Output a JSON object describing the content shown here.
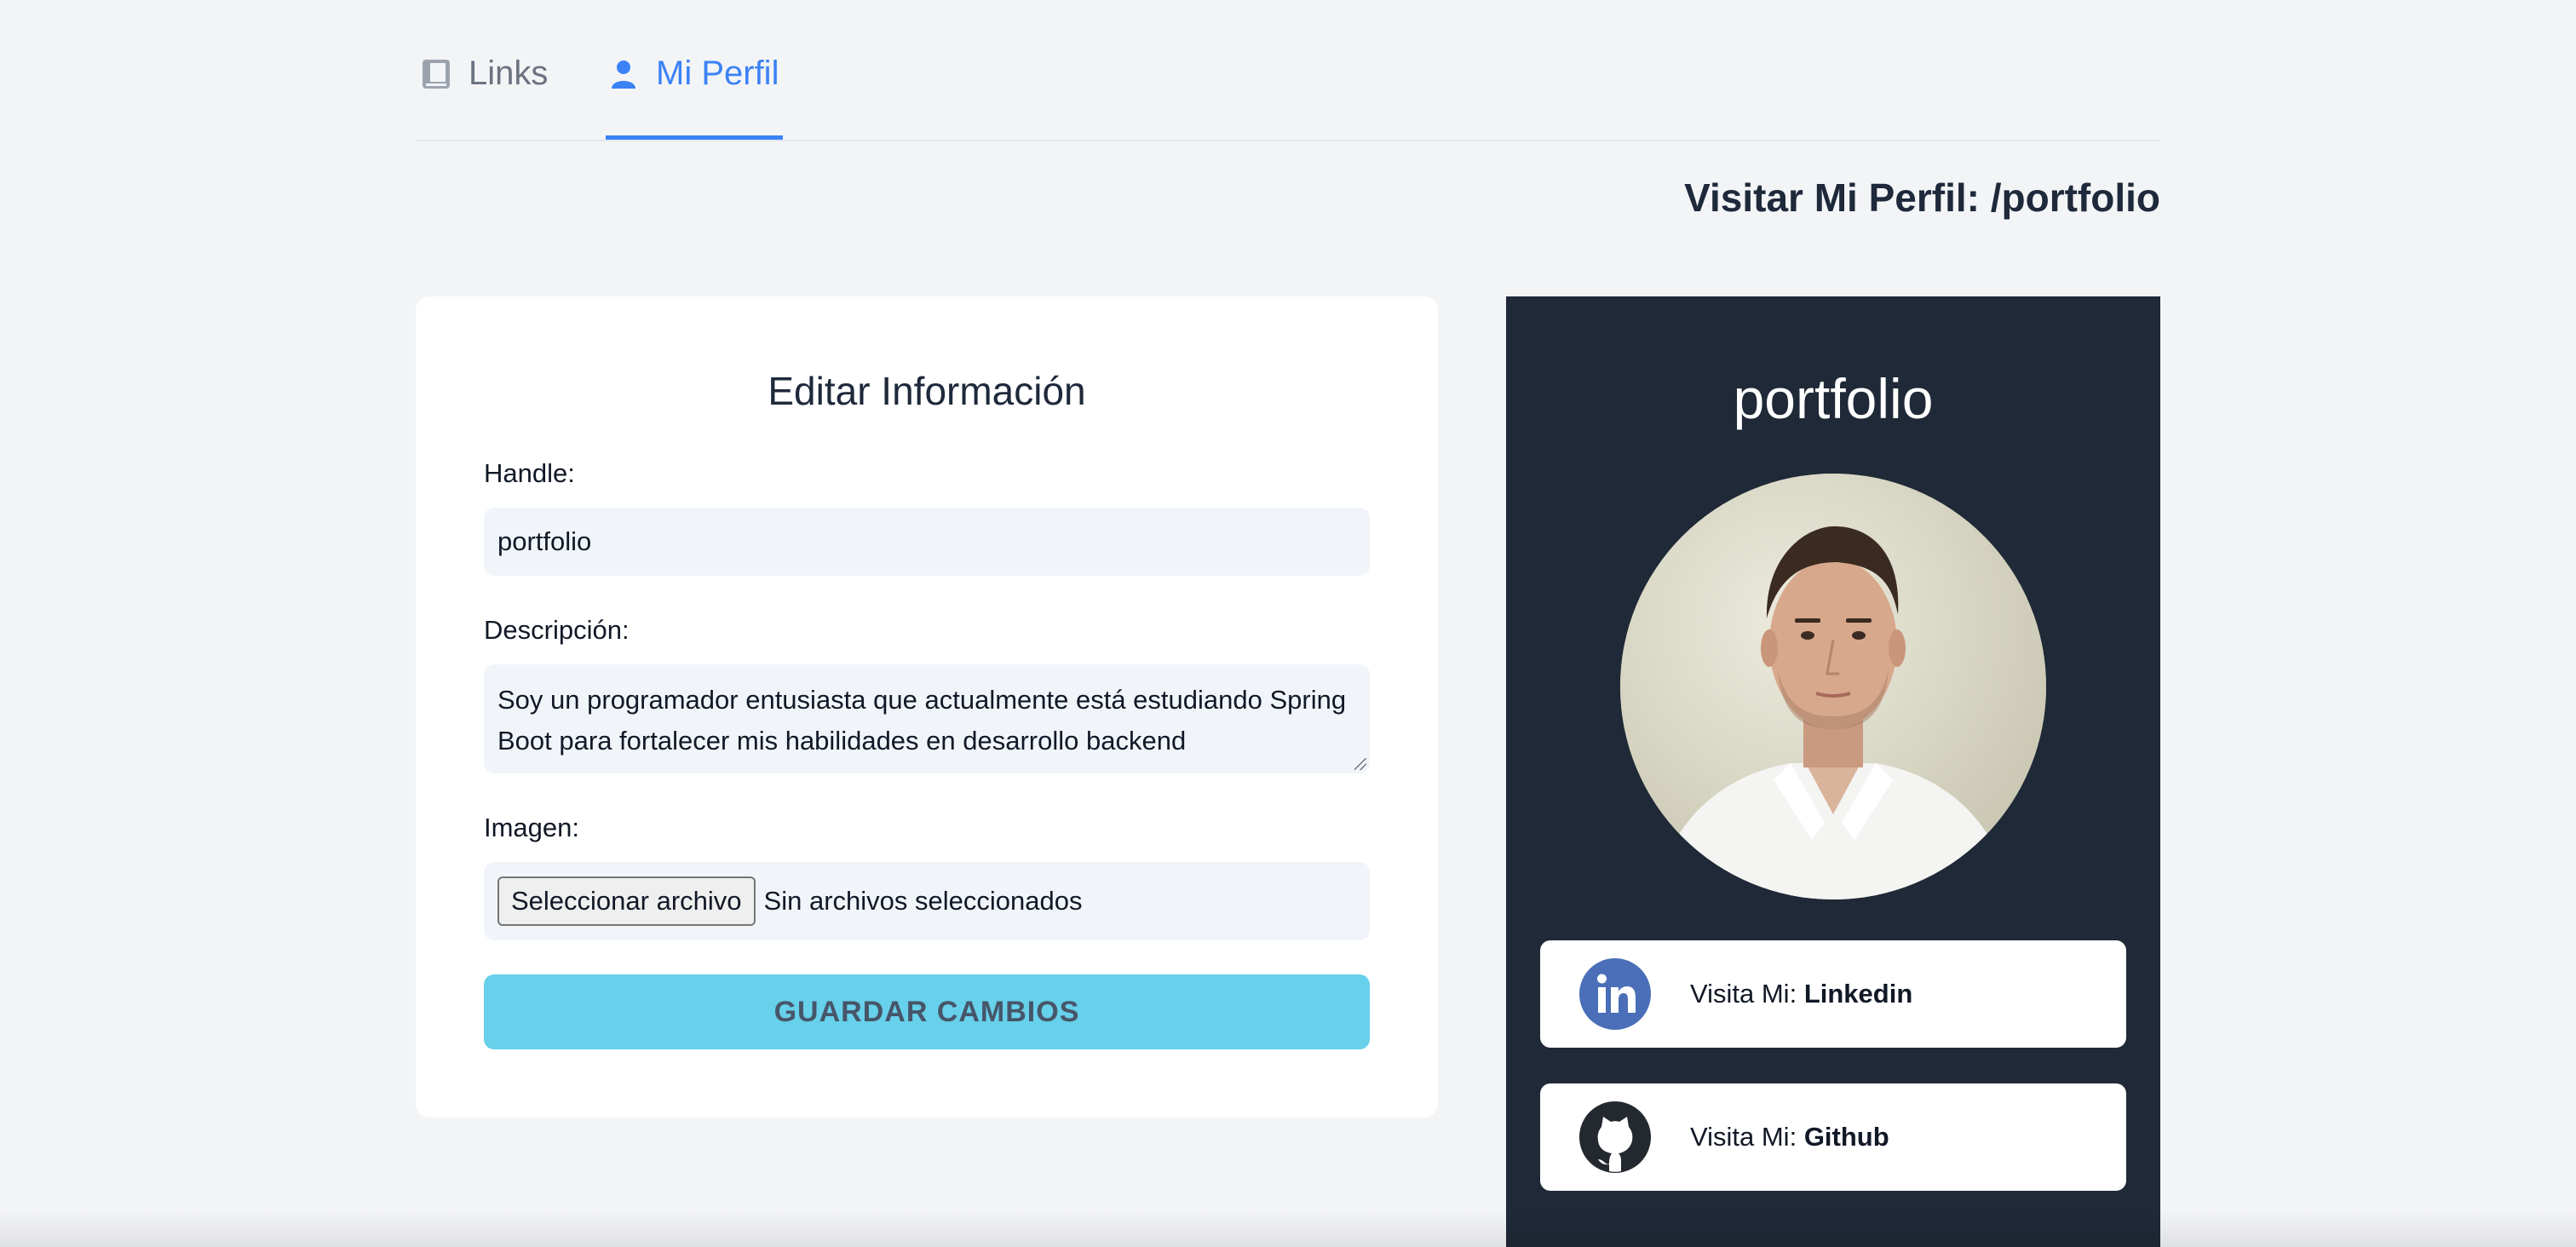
{
  "tabs": [
    {
      "label": "Links",
      "icon": "book-icon",
      "active": false
    },
    {
      "label": "Mi Perfil",
      "icon": "user-icon",
      "active": true
    }
  ],
  "visit_title": "Visitar Mi Perfil: /portfolio",
  "edit_form": {
    "title": "Editar Información",
    "handle_label": "Handle:",
    "handle_value": "portfolio",
    "description_label": "Descripción:",
    "description_value": "Soy un programador entusiasta que actualmente está estudiando Spring Boot para fortalecer mis habilidades en desarrollo backend",
    "image_label": "Imagen:",
    "file_button": "Seleccionar archivo",
    "file_status": "Sin archivos seleccionados",
    "save_button": "GUARDAR CAMBIOS"
  },
  "preview": {
    "handle": "portfolio",
    "socials": [
      {
        "prefix": "Visita Mi:",
        "name": "Linkedin",
        "icon": "linkedin-icon"
      },
      {
        "prefix": "Visita Mi:",
        "name": "Github",
        "icon": "github-icon"
      }
    ]
  },
  "colors": {
    "background": "#f3f4f6",
    "accent": "#3b82f6",
    "save_button": "#67d0ea",
    "preview_bg": "#1f2937",
    "linkedin": "#4a6fb8"
  }
}
